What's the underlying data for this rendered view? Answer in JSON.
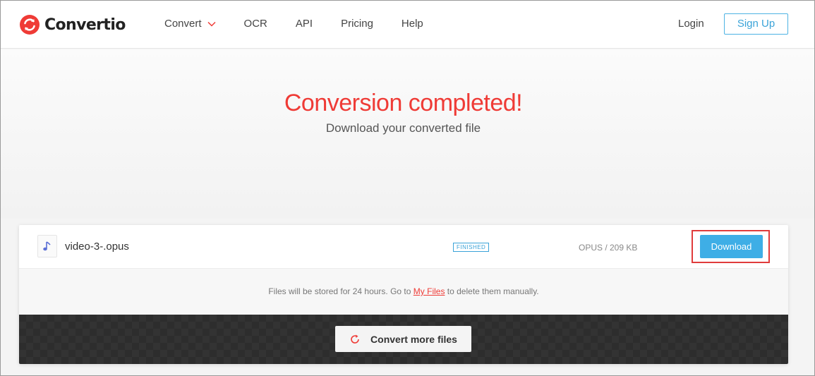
{
  "header": {
    "brand": "Convertio",
    "nav": [
      {
        "label": "Convert",
        "has_dropdown": true
      },
      {
        "label": "OCR"
      },
      {
        "label": "API"
      },
      {
        "label": "Pricing"
      },
      {
        "label": "Help"
      }
    ],
    "login_label": "Login",
    "signup_label": "Sign Up"
  },
  "hero": {
    "title": "Conversion completed!",
    "subtitle": "Download your converted file"
  },
  "file": {
    "icon": "music-note-icon",
    "name": "video-3-.opus",
    "status": "FINISHED",
    "meta": "OPUS / 209 KB",
    "download_label": "Download"
  },
  "note": {
    "text_before": "Files will be stored for 24 hours. Go to ",
    "link": "My Files",
    "text_after": " to delete them manually."
  },
  "actions": {
    "convert_more_label": "Convert more files"
  },
  "colors": {
    "brand_red": "#ef3b36",
    "accent_blue": "#3eaee6",
    "highlight_red": "#e03c3c"
  }
}
